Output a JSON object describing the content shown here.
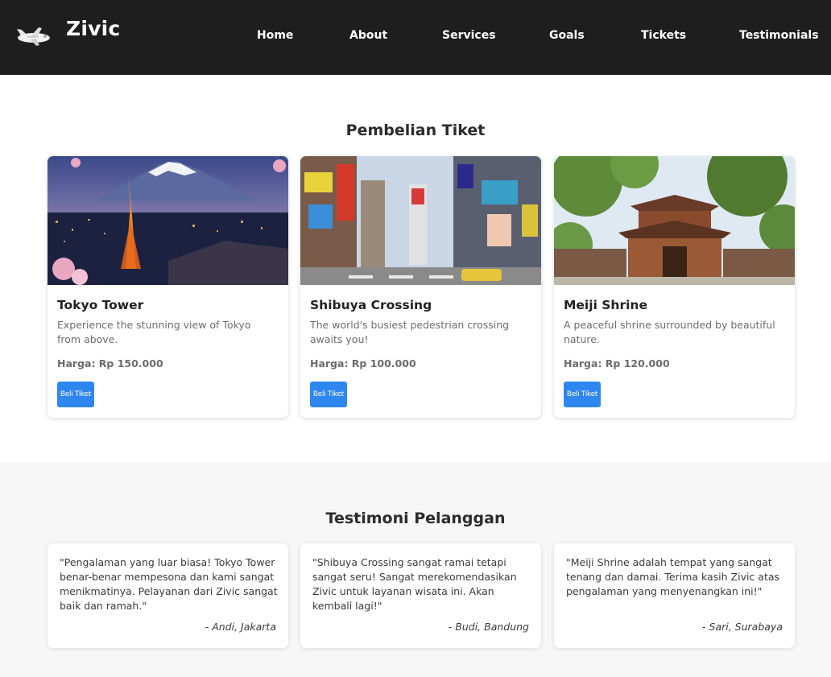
{
  "header": {
    "brand": "Zivic",
    "logo_icon": "airplane-icon",
    "nav": [
      {
        "label": "Home"
      },
      {
        "label": "About"
      },
      {
        "label": "Services"
      },
      {
        "label": "Goals"
      },
      {
        "label": "Tickets"
      },
      {
        "label": "Testimonials"
      }
    ]
  },
  "tickets": {
    "title": "Pembelian Tiket",
    "cards": [
      {
        "title": "Tokyo Tower",
        "description": "Experience the stunning view of Tokyo from above.",
        "price": "Harga: Rp 150.000",
        "button": "Beli Tiket",
        "image": "tokyo-tower-photo"
      },
      {
        "title": "Shibuya Crossing",
        "description": "The world's busiest pedestrian crossing awaits you!",
        "price": "Harga: Rp 100.000",
        "button": "Beli Tiket",
        "image": "shibuya-crossing-photo"
      },
      {
        "title": "Meiji Shrine",
        "description": "A peaceful shrine surrounded by beautiful nature.",
        "price": "Harga: Rp 120.000",
        "button": "Beli Tiket",
        "image": "meiji-shrine-photo"
      }
    ]
  },
  "testimonials": {
    "title": "Testimoni Pelanggan",
    "items": [
      {
        "quote": "\"Pengalaman yang luar biasa! Tokyo Tower benar-benar mempesona dan kami sangat menikmatinya. Pelayanan dari Zivic sangat baik dan ramah.\"",
        "author": "- Andi, Jakarta"
      },
      {
        "quote": "\"Shibuya Crossing sangat ramai tetapi sangat seru! Sangat merekomendasikan Zivic untuk layanan wisata ini. Akan kembali lagi!\"",
        "author": "- Budi, Bandung"
      },
      {
        "quote": "\"Meiji Shrine adalah tempat yang sangat tenang dan damai. Terima kasih Zivic atas pengalaman yang menyenangkan ini!\"",
        "author": "- Sari, Surabaya"
      }
    ]
  },
  "colors": {
    "navbar_bg": "#1e1e1e",
    "button_blue": "#2e86f0",
    "section_alt_bg": "#f7f7f7"
  }
}
